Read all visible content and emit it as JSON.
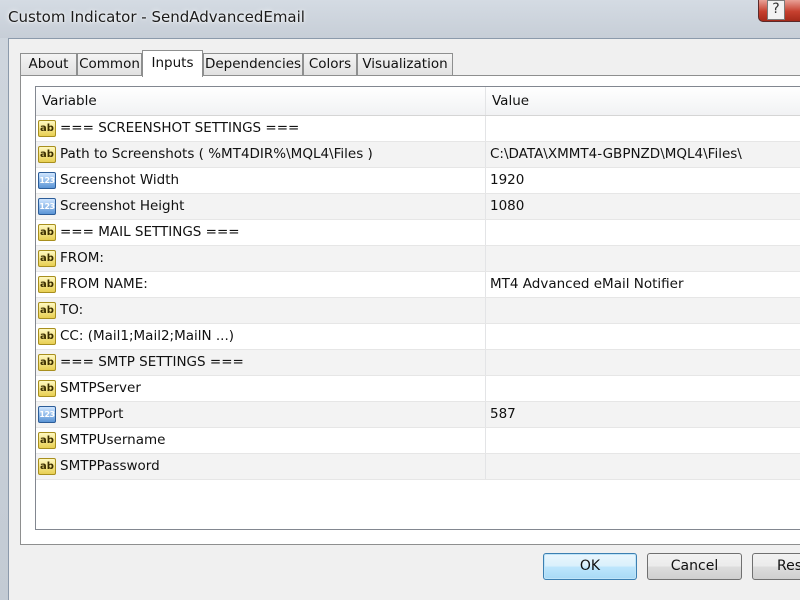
{
  "window": {
    "title": "Custom Indicator - SendAdvancedEmail",
    "close_glyph": "?"
  },
  "tabs": [
    {
      "label": "About",
      "active": false
    },
    {
      "label": "Common",
      "active": false
    },
    {
      "label": "Inputs",
      "active": true
    },
    {
      "label": "Dependencies",
      "active": false
    },
    {
      "label": "Colors",
      "active": false
    },
    {
      "label": "Visualization",
      "active": false
    }
  ],
  "grid": {
    "columns": {
      "variable": "Variable",
      "value": "Value"
    },
    "type_glyphs": {
      "str": "ab",
      "num": "123"
    },
    "rows": [
      {
        "type": "str",
        "variable": "=== SCREENSHOT SETTINGS ===",
        "value": ""
      },
      {
        "type": "str",
        "variable": "Path to Screenshots ( %MT4DIR%\\MQL4\\Files )",
        "value": "C:\\DATA\\XMMT4-GBPNZD\\MQL4\\Files\\"
      },
      {
        "type": "num",
        "variable": "Screenshot Width",
        "value": "1920"
      },
      {
        "type": "num",
        "variable": "Screenshot Height",
        "value": "1080"
      },
      {
        "type": "str",
        "variable": "=== MAIL SETTINGS ===",
        "value": ""
      },
      {
        "type": "str",
        "variable": "FROM:",
        "value": ""
      },
      {
        "type": "str",
        "variable": "FROM NAME:",
        "value": "MT4 Advanced eMail Notifier"
      },
      {
        "type": "str",
        "variable": "TO:",
        "value": ""
      },
      {
        "type": "str",
        "variable": "CC: (Mail1;Mail2;MailN ...)",
        "value": ""
      },
      {
        "type": "str",
        "variable": "=== SMTP SETTINGS ===",
        "value": ""
      },
      {
        "type": "str",
        "variable": "SMTPServer",
        "value": ""
      },
      {
        "type": "num",
        "variable": "SMTPPort",
        "value": "587"
      },
      {
        "type": "str",
        "variable": "SMTPUsername",
        "value": ""
      },
      {
        "type": "str",
        "variable": "SMTPPassword",
        "value": ""
      }
    ]
  },
  "buttons": {
    "ok": "OK",
    "cancel": "Cancel",
    "reset": "Res"
  },
  "colors": {
    "str_icon": "#e8cf52",
    "num_icon": "#5b95d6",
    "default_button": "#bee6fd"
  }
}
